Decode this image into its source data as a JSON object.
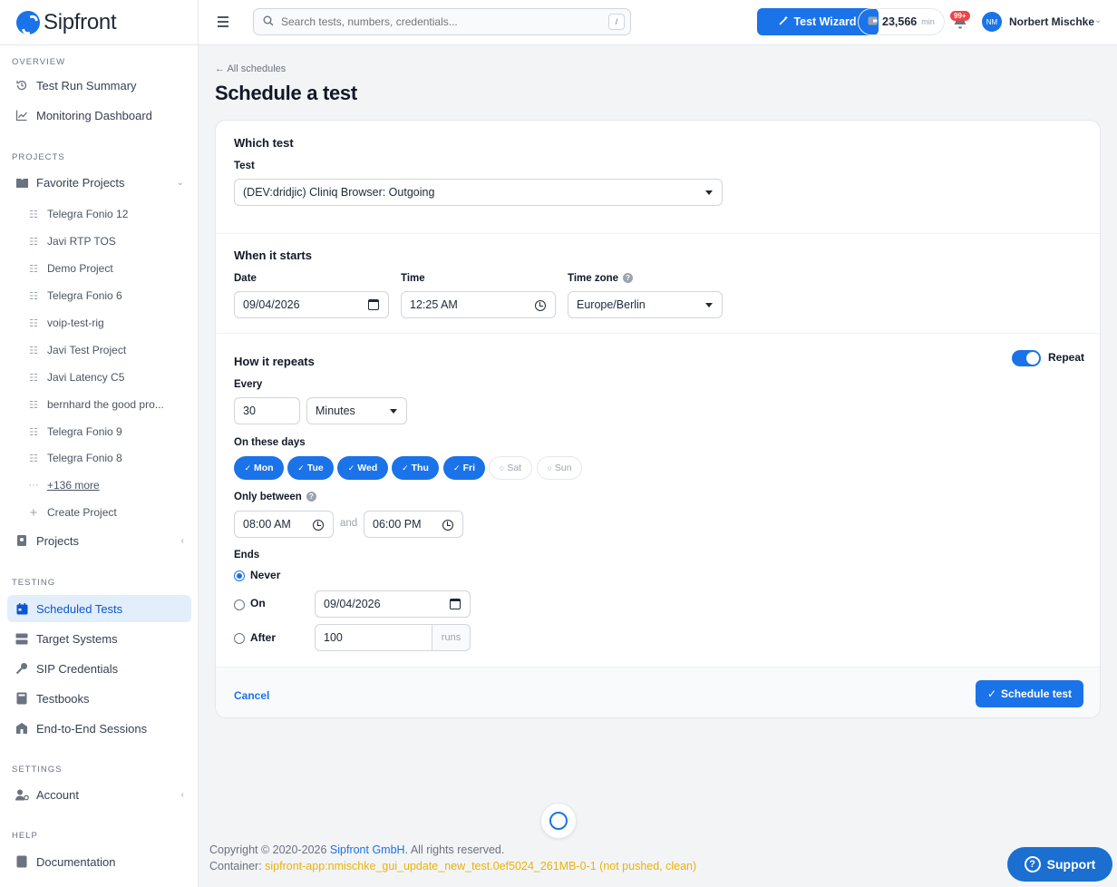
{
  "app": {
    "brand": "Sipfront"
  },
  "sidebar": {
    "overview_label": "OVERVIEW",
    "overview_items": [
      {
        "label": "Test Run Summary",
        "icon": "history-icon"
      },
      {
        "label": "Monitoring Dashboard",
        "icon": "chart-line-icon"
      }
    ],
    "projects_label": "PROJECTS",
    "favorite_projects": "Favorite Projects",
    "project_list": [
      "Telegra Fonio 12",
      "Javi RTP TOS",
      "Demo Project",
      "Telegra Fonio 6",
      "voip-test-rig",
      "Javi Test Project",
      "Javi Latency C5",
      "bernhard the good pro...",
      "Telegra Fonio 9",
      "Telegra Fonio 8"
    ],
    "more_projects": "+136 more",
    "create_project": "Create Project",
    "projects": "Projects",
    "testing_label": "TESTING",
    "testing_items": [
      {
        "label": "Scheduled Tests",
        "icon": "calendar-icon",
        "active": true
      },
      {
        "label": "Target Systems",
        "icon": "server-icon",
        "active": false
      },
      {
        "label": "SIP Credentials",
        "icon": "key-icon",
        "active": false
      },
      {
        "label": "Testbooks",
        "icon": "book-icon",
        "active": false
      },
      {
        "label": "End-to-End Sessions",
        "icon": "building-icon",
        "active": false
      }
    ],
    "settings_label": "SETTINGS",
    "account": "Account",
    "help_label": "HELP",
    "documentation": "Documentation"
  },
  "topbar": {
    "search_placeholder": "Search tests, numbers, credentials...",
    "search_shortcut": "/",
    "wizard_label": "Test Wizard",
    "credits_value": "23,566",
    "credits_unit": "min",
    "notification_badge": "99+",
    "avatar_initials": "NM",
    "user_name": "Norbert Mischke"
  },
  "main": {
    "back_link": "All schedules",
    "title": "Schedule a test",
    "which_test": {
      "title": "Which test",
      "test_label": "Test",
      "test_value": "(DEV:dridjic) Cliniq Browser: Outgoing"
    },
    "when_starts": {
      "title": "When it starts",
      "date_label": "Date",
      "date_value": "09/04/2026",
      "time_label": "Time",
      "time_value": "12:25 AM",
      "timezone_label": "Time zone",
      "timezone_value": "Europe/Berlin"
    },
    "how_repeats": {
      "title": "How it repeats",
      "repeat_toggle_label": "Repeat",
      "repeat_on": true,
      "every_label": "Every",
      "every_value": "30",
      "every_unit": "Minutes",
      "days_label": "On these days",
      "days": [
        {
          "label": "Mon",
          "on": true
        },
        {
          "label": "Tue",
          "on": true
        },
        {
          "label": "Wed",
          "on": true
        },
        {
          "label": "Thu",
          "on": true
        },
        {
          "label": "Fri",
          "on": true
        },
        {
          "label": "Sat",
          "on": false
        },
        {
          "label": "Sun",
          "on": false
        }
      ],
      "between_label": "Only between",
      "between_start": "08:00 AM",
      "between_and": "and",
      "between_end": "06:00 PM",
      "ends_label": "Ends",
      "ends_never": "Never",
      "ends_on": "On",
      "ends_on_date": "09/04/2026",
      "ends_after": "After",
      "ends_after_value": "100",
      "ends_after_unit": "runs",
      "ends_selected": "never"
    },
    "cancel_label": "Cancel",
    "schedule_label": "Schedule test"
  },
  "footer": {
    "copyright_prefix": "Copyright © 2020-2026 ",
    "copyright_brand": "Sipfront GmbH",
    "copyright_suffix": ". All rights reserved.",
    "container_label": "Container: ",
    "container_value": "sipfront-app:nmischke_gui_update_new_test.0ef5024_261MB-0-1 (not pushed, clean)",
    "support_label": "Support"
  },
  "colors": {
    "accent": "#1a73e8",
    "active_bg": "#e3eefb",
    "badge": "#ef4444",
    "container_text": "#eab308"
  }
}
